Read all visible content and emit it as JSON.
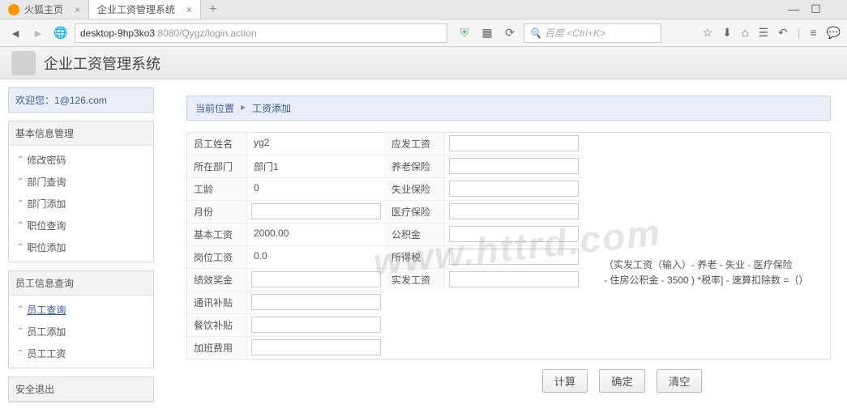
{
  "browser": {
    "tab1": "火狐主页",
    "tab2": "企业工资管理系统",
    "url_host": "desktop-9hp3ko3",
    "url_rest": ":8080/Qygz/login.action",
    "search_placeholder": "百度 <Ctrl+K>"
  },
  "header": {
    "title": "企业工资管理系统"
  },
  "sidebar": {
    "welcome": "欢迎您：1@126.com",
    "panel1_title": "基本信息管理",
    "panel1_items": [
      "修改密码",
      "部门查询",
      "部门添加",
      "职位查询",
      "职位添加"
    ],
    "panel2_title": "员工信息查询",
    "panel2_items": [
      "员工查询",
      "员工添加",
      "员工工资"
    ],
    "panel3_title": "安全退出"
  },
  "breadcrumb": {
    "loc": "当前位置",
    "page": "工资添加"
  },
  "form": {
    "left": {
      "name_lbl": "员工姓名",
      "name_val": "yg2",
      "dept_lbl": "所在部门",
      "dept_val": "部门1",
      "age_lbl": "工龄",
      "age_val": "0",
      "month_lbl": "月份",
      "month_val": "",
      "base_lbl": "基本工资",
      "base_val": "2000.00",
      "post_lbl": "岗位工资",
      "post_val": "0.0",
      "perf_lbl": "绩效奖金",
      "perf_val": "",
      "comm_lbl": "通讯补贴",
      "comm_val": "",
      "food_lbl": "餐饮补贴",
      "food_val": "",
      "ot_lbl": "加班费用",
      "ot_val": ""
    },
    "right": {
      "gross_lbl": "应发工资",
      "gross_val": "",
      "pension_lbl": "养老保险",
      "pension_val": "",
      "unemp_lbl": "失业保险",
      "unemp_val": "",
      "med_lbl": "医疗保险",
      "med_val": "",
      "fund_lbl": "公积金",
      "fund_val": "",
      "tax_lbl": "所得税",
      "tax_val": "",
      "net_lbl": "实发工资",
      "net_val": ""
    }
  },
  "formula": {
    "line1": "（实发工资（输入）- 养老 - 失业 - 医疗保险",
    "line2": "- 住房公积金 - 3500 ) *税率] - 速算扣除数 =（）"
  },
  "buttons": {
    "calc": "计算",
    "ok": "确定",
    "clear": "清空"
  },
  "watermark": "www.httrd.com"
}
